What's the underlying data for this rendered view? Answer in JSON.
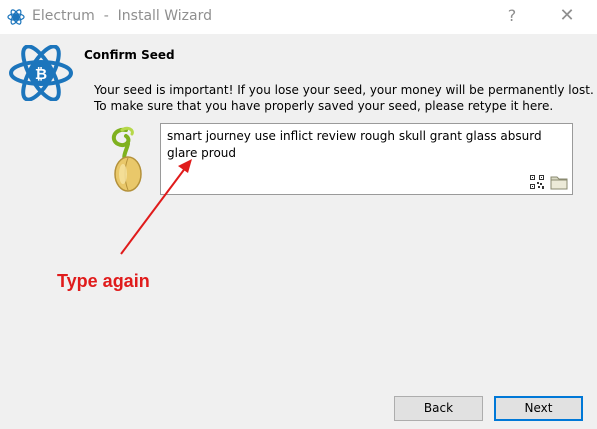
{
  "window": {
    "title": "Electrum  -  Install Wizard",
    "help_label": "?",
    "close_label": "✕"
  },
  "page": {
    "heading": "Confirm Seed",
    "message_line1": "Your seed is important! If you lose your seed, your money will be permanently lost.",
    "message_line2": "To make sure that you have properly saved your seed, please retype it here."
  },
  "seed_input": {
    "value": "smart journey use inflict review rough skull grant glass absurd glare proud"
  },
  "annotation": {
    "text": "Type again",
    "color": "#e01b1b"
  },
  "buttons": {
    "back": "Back",
    "next": "Next"
  },
  "colors": {
    "electrum_blue": "#1c75bc",
    "focus_blue": "#0078d7"
  }
}
